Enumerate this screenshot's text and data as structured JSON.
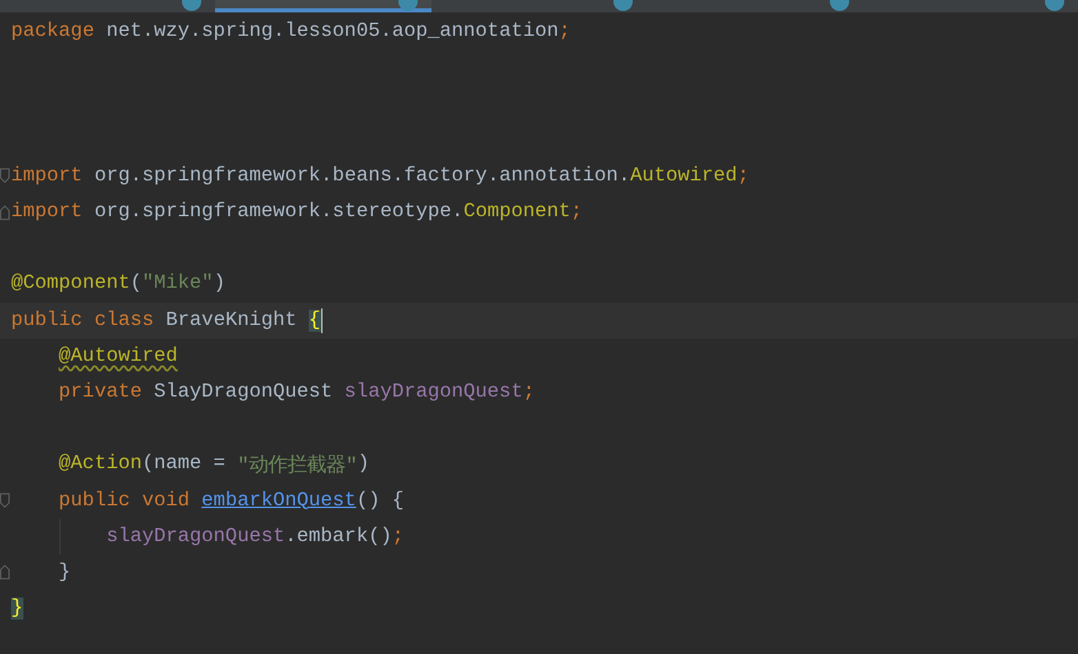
{
  "tabs": [
    {
      "selected": false
    },
    {
      "selected": true
    },
    {
      "selected": false
    },
    {
      "selected": false
    },
    {
      "selected": false
    }
  ],
  "editor": {
    "lines": [
      {
        "current": false,
        "tokens": [
          {
            "kind": "keyword",
            "text": "package"
          },
          {
            "kind": "plain",
            "text": " net.wzy.spring.lesson05.aop_annotation"
          },
          {
            "kind": "keyword",
            "text": ";"
          }
        ]
      },
      {
        "current": false
      },
      {
        "current": false
      },
      {
        "current": false
      },
      {
        "current": false,
        "fold": {
          "kind": "start"
        },
        "tokens": [
          {
            "kind": "keyword",
            "text": "import"
          },
          {
            "kind": "plain",
            "text": " org.springframework.beans.factory.annotation."
          },
          {
            "kind": "annotation",
            "text": "Autowired"
          },
          {
            "kind": "keyword",
            "text": ";"
          }
        ]
      },
      {
        "current": false,
        "fold": {
          "kind": "end"
        },
        "tokens": [
          {
            "kind": "keyword",
            "text": "import"
          },
          {
            "kind": "plain",
            "text": " org.springframework.stereotype."
          },
          {
            "kind": "annotation",
            "text": "Component"
          },
          {
            "kind": "keyword",
            "text": ";"
          }
        ]
      },
      {
        "current": false
      },
      {
        "current": false,
        "tokens": [
          {
            "kind": "annotation",
            "text": "@Component"
          },
          {
            "kind": "plain",
            "text": "("
          },
          {
            "kind": "string",
            "text": "\"Mike\""
          },
          {
            "kind": "plain",
            "text": ")"
          }
        ]
      },
      {
        "current": true,
        "tokens": [
          {
            "kind": "keyword",
            "text": "public class"
          },
          {
            "kind": "plain",
            "text": " BraveKnight "
          },
          {
            "kind": "brace",
            "text": "{"
          }
        ],
        "children": [
          {
            "current": false,
            "tokens": [
              {
                "kind": "warning",
                "text": "@Autowired"
              }
            ]
          },
          {
            "current": false,
            "tokens": [
              {
                "kind": "keyword",
                "text": "private"
              },
              {
                "kind": "plain",
                "text": " SlayDragonQuest "
              },
              {
                "kind": "field",
                "text": "slayDragonQuest"
              },
              {
                "kind": "keyword",
                "text": ";"
              }
            ]
          },
          {
            "current": false
          },
          {
            "current": false,
            "tokens": [
              {
                "kind": "annotation",
                "text": "@Action"
              },
              {
                "kind": "plain",
                "text": "(name = "
              },
              {
                "kind": "string",
                "text": "\"动作拦截器\""
              },
              {
                "kind": "plain",
                "text": ")"
              }
            ]
          },
          {
            "current": false,
            "fold": {
              "kind": "start"
            },
            "tokens": [
              {
                "kind": "keyword",
                "text": "public void "
              },
              {
                "kind": "method",
                "text": "embarkOnQuest"
              },
              {
                "kind": "plain",
                "text": "() {"
              }
            ],
            "children": [
              {
                "current": false,
                "guide": true,
                "tokens": [
                  {
                    "kind": "field",
                    "text": "slayDragonQuest"
                  },
                  {
                    "kind": "plain",
                    "text": ".embark()"
                  },
                  {
                    "kind": "keyword",
                    "text": ";"
                  }
                ]
              }
            ]
          },
          {
            "current": false,
            "fold": {
              "kind": "end"
            },
            "tokens": [
              {
                "kind": "plain",
                "text": "}"
              }
            ]
          }
        ]
      },
      {
        "current": false,
        "tokens": [
          {
            "kind": "brace",
            "text": "}"
          }
        ]
      }
    ]
  }
}
